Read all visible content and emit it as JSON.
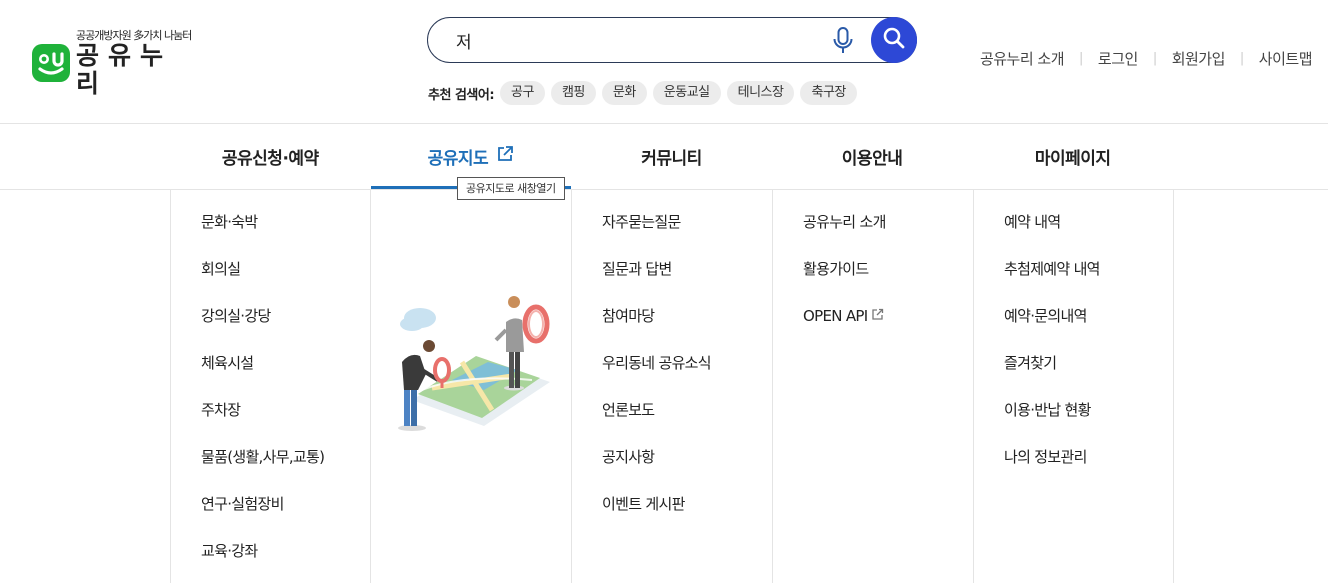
{
  "logo": {
    "sub": "공공개방자원 多가치 나눔터",
    "main": "공유누리",
    "mark_text": "ou"
  },
  "search": {
    "value": "저",
    "placeholder": ""
  },
  "recommend": {
    "label": "추천 검색어:",
    "chips": [
      "공구",
      "캠핑",
      "문화",
      "운동교실",
      "테니스장",
      "축구장"
    ]
  },
  "util_links": [
    "공유누리 소개",
    "로그인",
    "회원가입",
    "사이트맵"
  ],
  "gnb": [
    {
      "label": "공유신청·예약"
    },
    {
      "label": "공유지도"
    },
    {
      "label": "커뮤니티"
    },
    {
      "label": "이용안내"
    },
    {
      "label": "마이페이지"
    }
  ],
  "tooltip": "공유지도로 새창열기",
  "menu": {
    "reserve": [
      "문화·숙박",
      "회의실",
      "강의실·강당",
      "체육시설",
      "주차장",
      "물품(생활,사무,교통)",
      "연구·실험장비",
      "교육·강좌"
    ],
    "community": [
      "자주묻는질문",
      "질문과 답변",
      "참여마당",
      "우리동네 공유소식",
      "언론보도",
      "공지사항",
      "이벤트 게시판"
    ],
    "guide": [
      "공유누리 소개",
      "활용가이드",
      "OPEN API"
    ],
    "mypage": [
      "예약 내역",
      "추첨제예약 내역",
      "예약·문의내역",
      "즐겨찾기",
      "이용·반납 현황",
      "나의 정보관리"
    ]
  },
  "colors": {
    "accent": "#1e6fb8",
    "search_button": "#2d48d6",
    "logo_green": "#1fb23a"
  }
}
